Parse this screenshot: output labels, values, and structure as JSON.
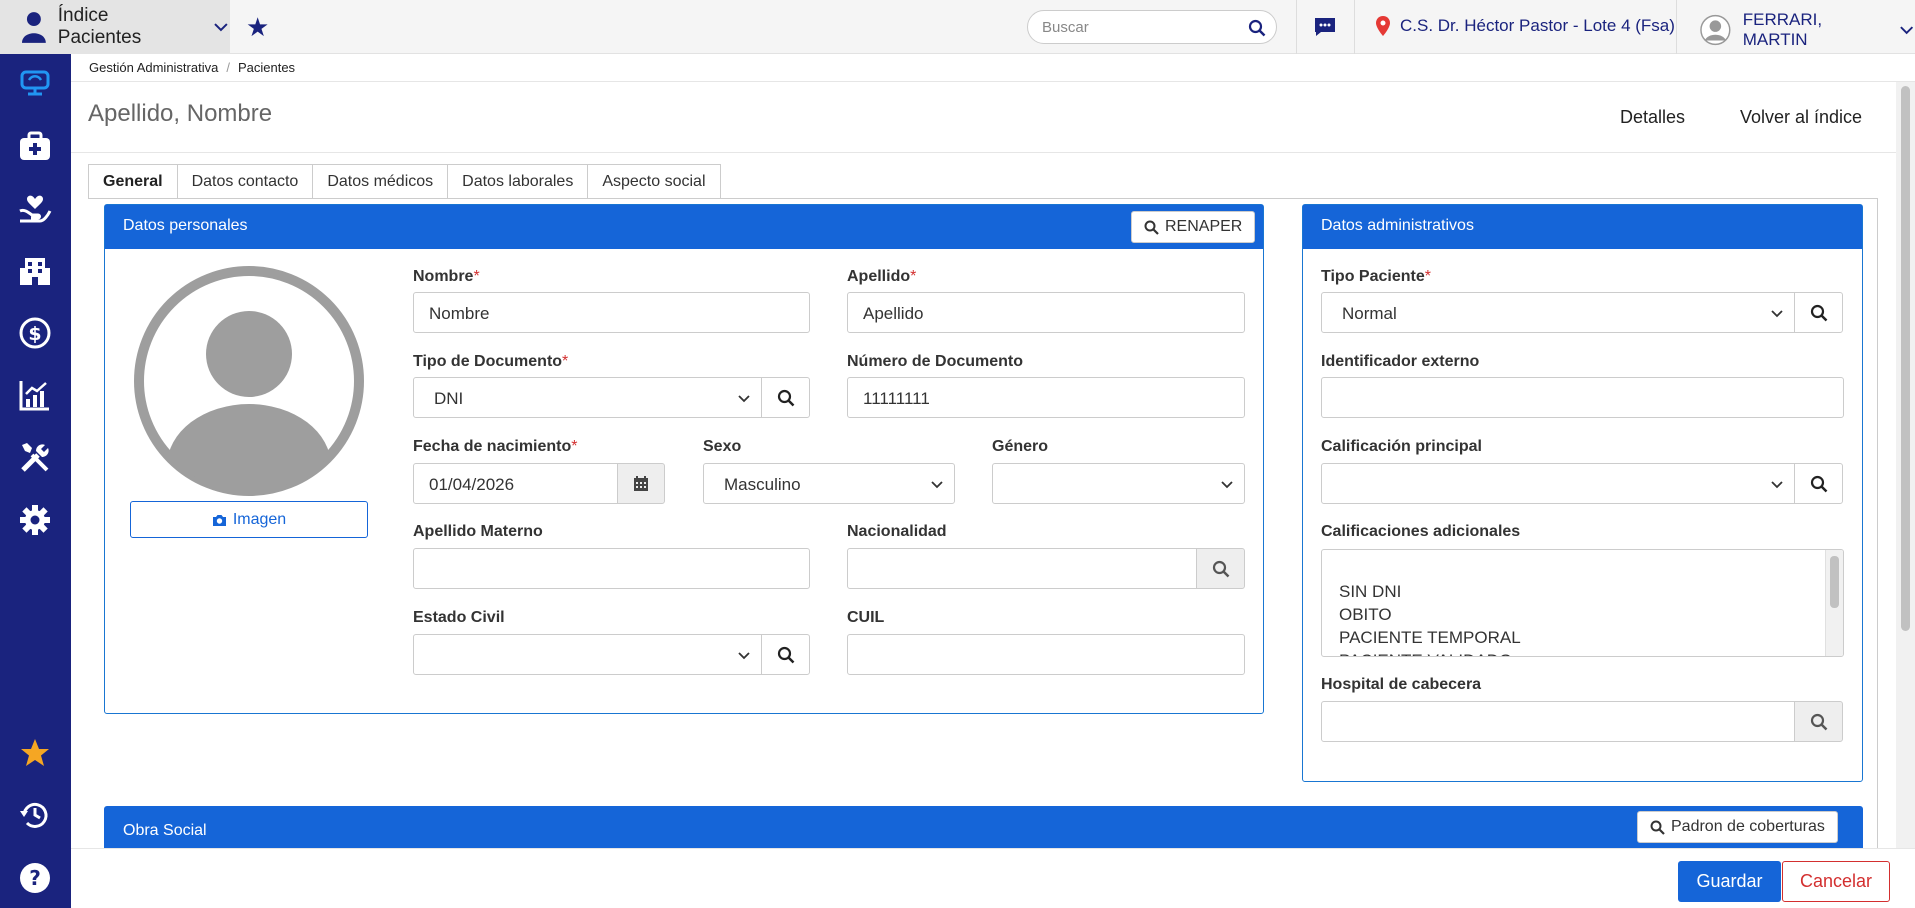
{
  "topbar": {
    "module_label": "Índice Pacientes",
    "search_placeholder": "Buscar",
    "location": "C.S. Dr. Héctor Pastor - Lote 4 (Fsa)",
    "user_name": "FERRARI, MARTIN"
  },
  "sidebar": {
    "items": [
      "monitor-icon",
      "medkit-icon",
      "care-hands-icon",
      "building-icon",
      "dollar-icon",
      "chart-icon",
      "tools-icon",
      "gear-icon",
      "star-icon",
      "history-icon",
      "help-icon"
    ],
    "star_color": "#f5a623",
    "bg_color": "#1a237e"
  },
  "breadcrumb": [
    "Gestión Administrativa",
    "Pacientes"
  ],
  "page": {
    "title": "Apellido, Nombre",
    "details_link": "Detalles",
    "back_link": "Volver al índice"
  },
  "tabs": [
    "General",
    "Datos contacto",
    "Datos médicos",
    "Datos laborales",
    "Aspecto social"
  ],
  "personal": {
    "header": "Datos personales",
    "renaper_btn": "RENAPER",
    "image_btn": "Imagen",
    "nombre_label": "Nombre",
    "nombre_value": "Nombre",
    "apellido_label": "Apellido",
    "apellido_value": "Apellido",
    "tipo_doc_label": "Tipo de Documento",
    "tipo_doc_value": "DNI",
    "num_doc_label": "Número de Documento",
    "num_doc_value": "11111111",
    "fecha_label": "Fecha de nacimiento",
    "fecha_value": "01/04/2026",
    "sexo_label": "Sexo",
    "sexo_value": "Masculino",
    "genero_label": "Género",
    "genero_value": "",
    "ap_materno_label": "Apellido Materno",
    "ap_materno_value": "",
    "nacionalidad_label": "Nacionalidad",
    "nacionalidad_value": "",
    "estado_civil_label": "Estado Civil",
    "estado_civil_value": "",
    "cuil_label": "CUIL",
    "cuil_value": ""
  },
  "admin": {
    "header": "Datos administrativos",
    "tipo_paciente_label": "Tipo Paciente",
    "tipo_paciente_value": "Normal",
    "id_externo_label": "Identificador externo",
    "id_externo_value": "",
    "calif_principal_label": "Calificación principal",
    "calif_principal_value": "",
    "calif_adicionales_label": "Calificaciones adicionales",
    "calif_adicionales": [
      "SIN DNI",
      "OBITO",
      "PACIENTE TEMPORAL",
      "PACIENTE VALIDADO"
    ],
    "hospital_label": "Hospital de cabecera",
    "hospital_value": ""
  },
  "obra_social": {
    "header": "Obra Social",
    "padron_btn": "Padron de coberturas"
  },
  "footer": {
    "save": "Guardar",
    "cancel": "Cancelar"
  },
  "colors": {
    "primary": "#1565d8",
    "required": "#d32f2f",
    "nav": "#1a237e"
  }
}
